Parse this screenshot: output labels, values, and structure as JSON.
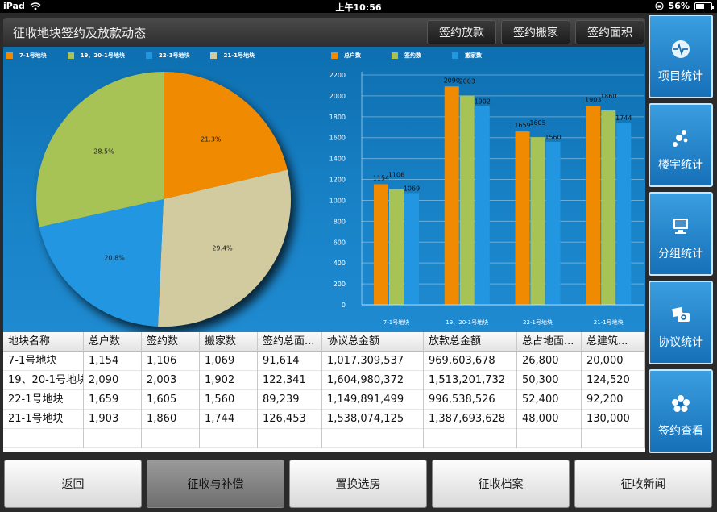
{
  "status_bar": {
    "device": "iPad",
    "time": "上午10:56",
    "battery": "56%",
    "battery_level": 0.56
  },
  "header": {
    "title": "征收地块签约及放款动态",
    "buttons": [
      "签约放款",
      "签约搬家",
      "签约面积"
    ]
  },
  "sidebar": {
    "items": [
      {
        "label": "项目统计",
        "icon": "heartbeat-icon"
      },
      {
        "label": "楼宇统计",
        "icon": "bubbles-icon"
      },
      {
        "label": "分组统计",
        "icon": "computer-icon"
      },
      {
        "label": "协议统计",
        "icon": "camera-photos-icon"
      },
      {
        "label": "签约查看",
        "icon": "flower-icon"
      }
    ]
  },
  "colors": {
    "orange": "#f08a00",
    "green": "#a7c255",
    "blue": "#2296e0",
    "tan": "#d2cba0"
  },
  "chart_data": [
    {
      "type": "pie",
      "legend": [
        "7-1号地块",
        "19、20-1号地块",
        "22-1号地块",
        "21-1号地块"
      ],
      "slice_labels": [
        "21.3%",
        "28.5%",
        "20.8%",
        "29.4%"
      ],
      "values": [
        21.3,
        28.5,
        20.8,
        29.4
      ]
    },
    {
      "type": "bar",
      "categories": [
        "7-1号地块",
        "19、20-1号地块",
        "22-1号地块",
        "21-1号地块"
      ],
      "series": [
        {
          "name": "总户数",
          "values": [
            1154,
            2090,
            1659,
            1903
          ]
        },
        {
          "name": "签约数",
          "values": [
            1106,
            2003,
            1605,
            1860
          ]
        },
        {
          "name": "搬家数",
          "values": [
            1069,
            1902,
            1560,
            1744
          ]
        }
      ],
      "ylim": [
        0,
        2200
      ],
      "yticks": [
        "0",
        "200",
        "400",
        "600",
        "800",
        "1000",
        "1200",
        "1400",
        "1600",
        "1800",
        "2000",
        "2200"
      ],
      "grid": true
    }
  ],
  "table": {
    "headers": [
      "地块名称",
      "总户数",
      "签约数",
      "搬家数",
      "签约总面...",
      "协议总金额",
      "放款总金额",
      "总占地面...",
      "总建筑..."
    ],
    "rows": [
      [
        "7-1号地块",
        "1,154",
        "1,106",
        "1,069",
        "91,614",
        "1,017,309,537",
        "969,603,678",
        "26,800",
        "20,000"
      ],
      [
        "19、20-1号地块",
        "2,090",
        "2,003",
        "1,902",
        "122,341",
        "1,604,980,372",
        "1,513,201,732",
        "50,300",
        "124,520"
      ],
      [
        "22-1号地块",
        "1,659",
        "1,605",
        "1,560",
        "89,239",
        "1,149,891,499",
        "996,538,526",
        "52,400",
        "92,200"
      ],
      [
        "21-1号地块",
        "1,903",
        "1,860",
        "1,744",
        "126,453",
        "1,538,074,125",
        "1,387,693,628",
        "48,000",
        "130,000"
      ]
    ]
  },
  "bottom_nav": {
    "items": [
      "返回",
      "征收与补偿",
      "置换选房",
      "征收档案",
      "征收新闻"
    ],
    "active_index": 1
  }
}
